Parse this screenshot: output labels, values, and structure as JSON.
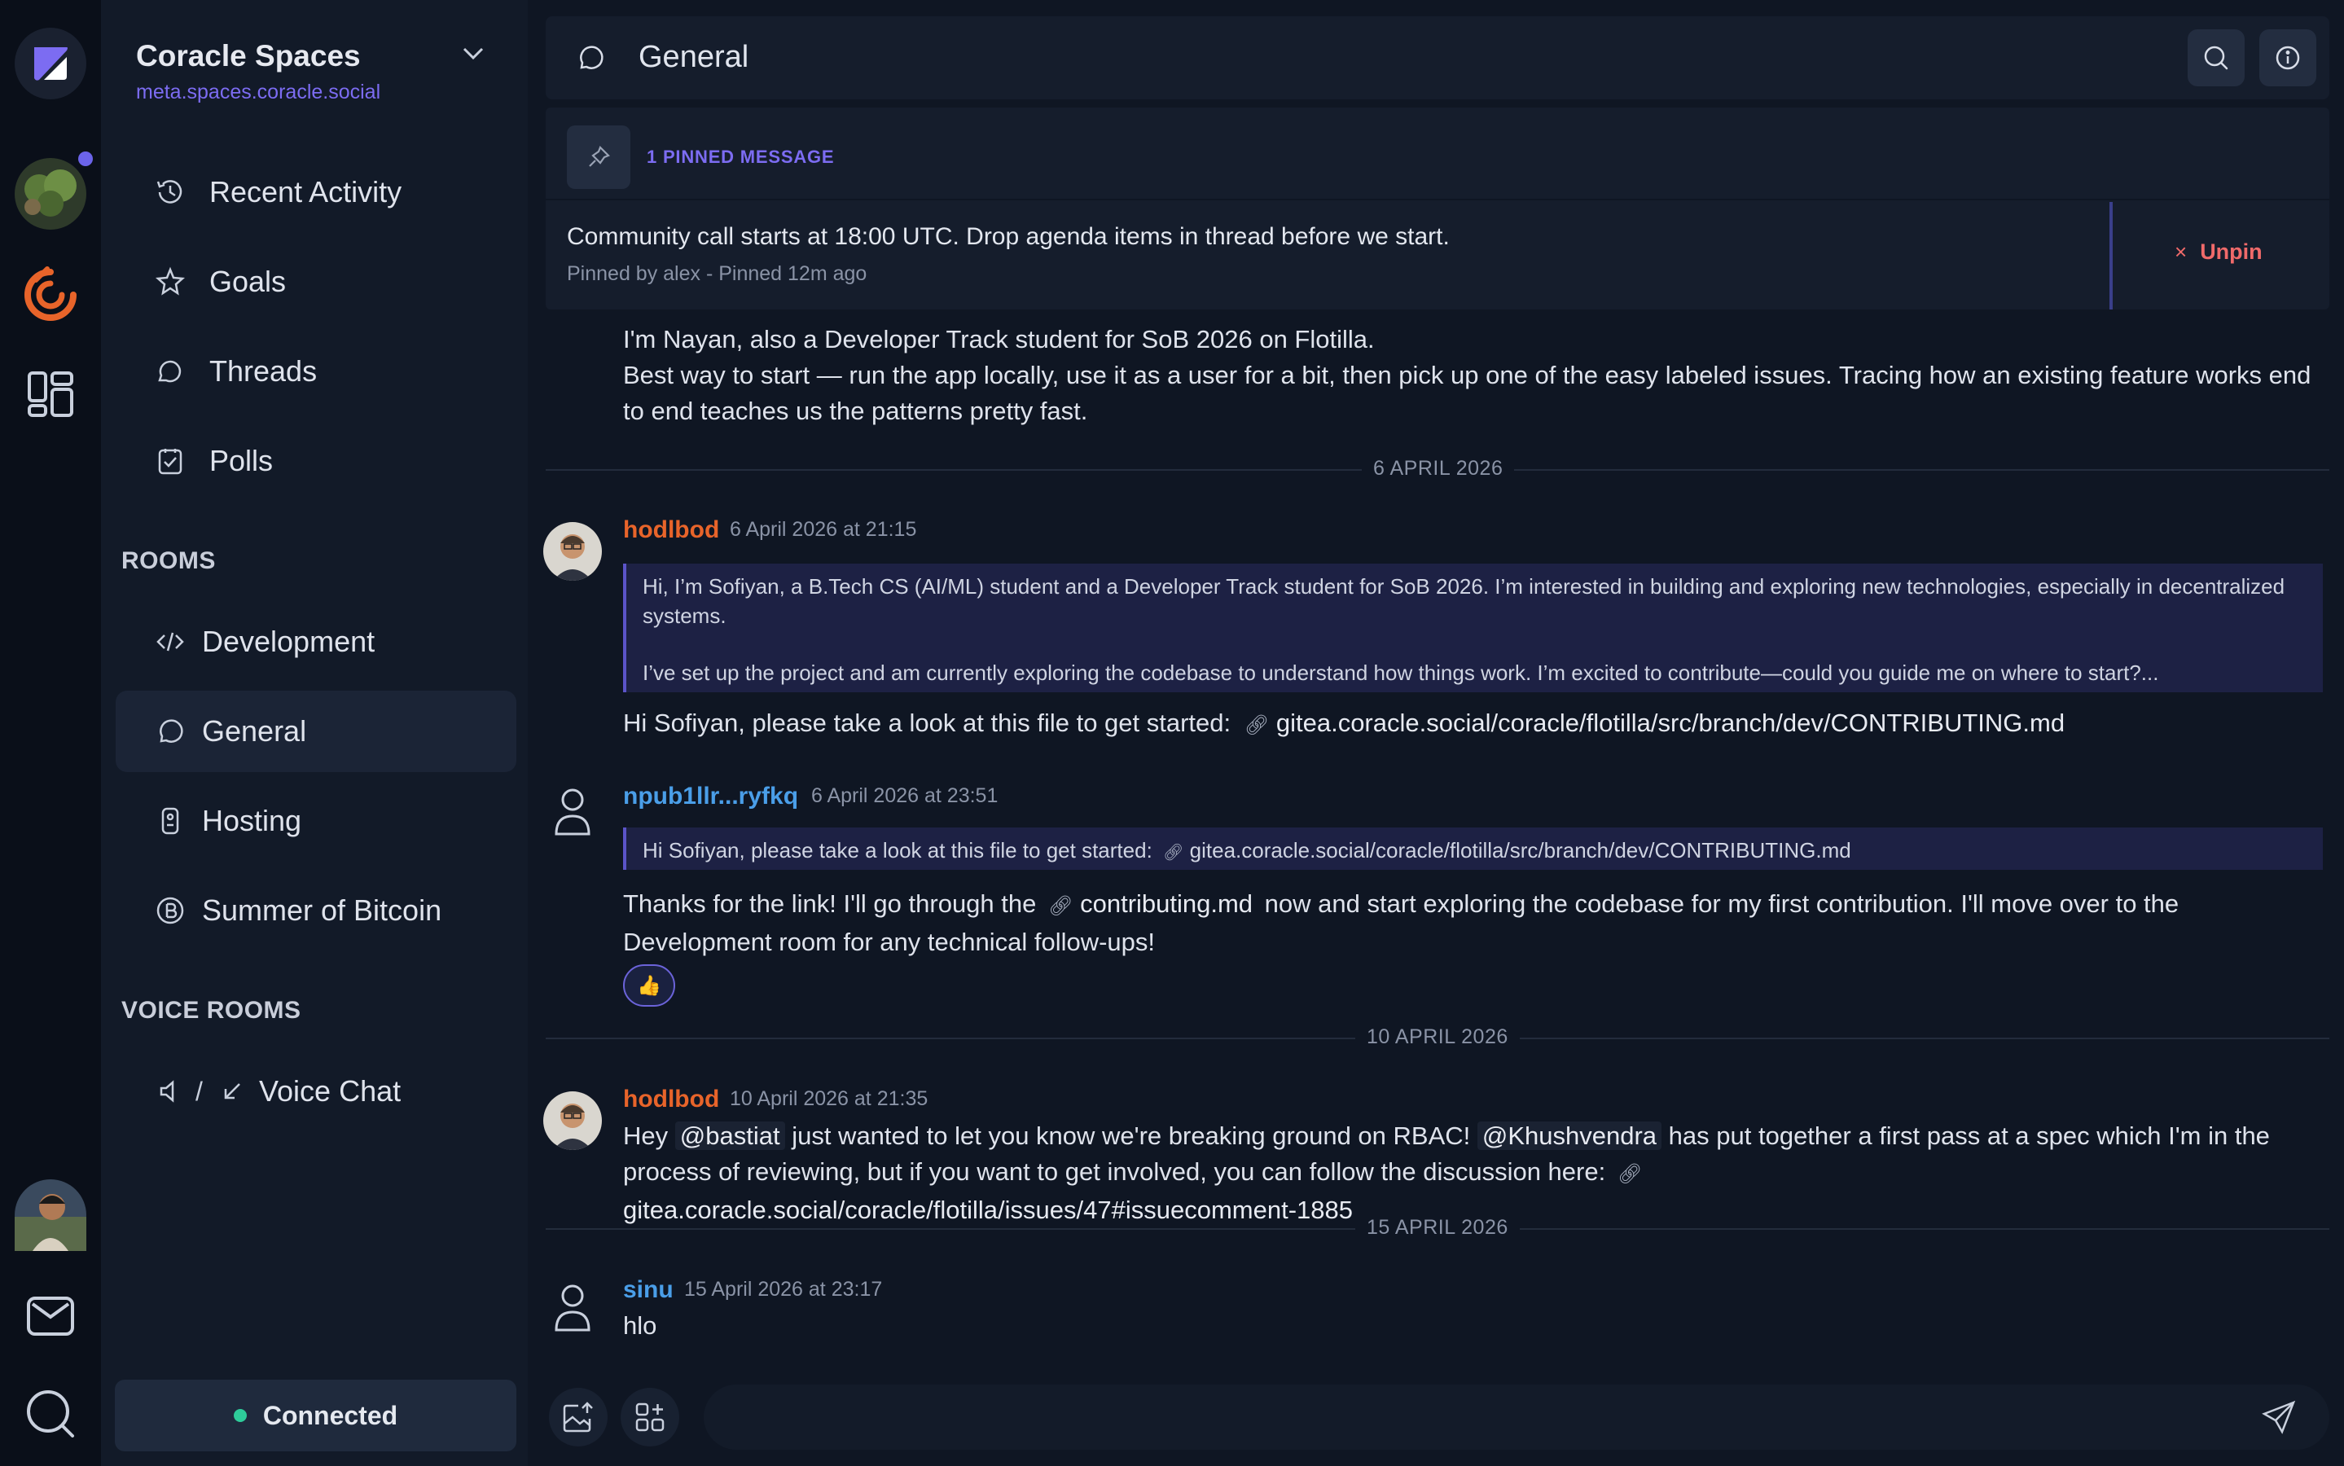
{
  "space": {
    "name": "Coracle Spaces",
    "url": "meta.spaces.coracle.social"
  },
  "nav": {
    "items": [
      {
        "label": "Recent Activity",
        "icon": "history-icon"
      },
      {
        "label": "Goals",
        "icon": "star-icon"
      },
      {
        "label": "Threads",
        "icon": "thread-icon"
      },
      {
        "label": "Polls",
        "icon": "poll-icon"
      }
    ]
  },
  "rooms": {
    "heading": "ROOMS",
    "items": [
      {
        "label": "Development",
        "icon": "code-icon"
      },
      {
        "label": "General",
        "icon": "chat-bubble-icon"
      },
      {
        "label": "Hosting",
        "icon": "server-icon"
      },
      {
        "label": "Summer of Bitcoin",
        "icon": "bitcoin-icon"
      }
    ]
  },
  "voice": {
    "heading": "VOICE ROOMS",
    "sep": "/",
    "items": [
      {
        "label": "Voice Chat"
      }
    ]
  },
  "status": {
    "connected": "Connected",
    "color": "#2ecc9a"
  },
  "channel": {
    "title": "General"
  },
  "pinned": {
    "count_label": "1 PINNED MESSAGE",
    "text": "Community call starts at 18:00 UTC. Drop agenda items in thread before we start.",
    "meta": "Pinned by alex - Pinned 12m ago",
    "unpin_label": "Unpin",
    "unpin_x": "×"
  },
  "messages": {
    "intro_line1": "I'm Nayan, also a Developer Track student for SoB 2026 on Flotilla.",
    "intro_line2": "Best way to start — run the app locally, use it as a user for a bit, then pick up one of the easy labeled issues. Tracing how an existing feature works end to end teaches us the patterns pretty fast.",
    "date1": "6 APRIL 2026",
    "m1_author": "hodlbod",
    "m1_time": "6 April 2026 at 21:15",
    "m1_quote_p1": "Hi, I’m Sofiyan, a B.Tech CS (AI/ML) student and a Developer Track student for SoB 2026. I’m interested in building and exploring new technologies, especially in decentralized systems.",
    "m1_quote_p2": "I’ve set up the project and am currently exploring the codebase to understand how things work. I’m excited to contribute—could you guide me on where to start?...",
    "m1_text": "Hi Sofiyan, please take a look at this file to get started:",
    "m1_link": "gitea.coracle.social/coracle/flotilla/src/branch/dev/CONTRIBUTING.md",
    "m2_author": "npub1llr...ryfkq",
    "m2_time": "6 April 2026 at 23:51",
    "m2_quote": "Hi Sofiyan, please take a look at this file to get started:",
    "m2_quote_link": "gitea.coracle.social/coracle/flotilla/src/branch/dev/CONTRIBUTING.md",
    "m2_text_a": "Thanks for the link! I'll go through the",
    "m2_link": "contributing.md",
    "m2_text_b": "now and start exploring the codebase for my first contribution. I'll move over to the Development room for any technical follow-ups!",
    "m2_reaction": "👍",
    "date2": "10 APRIL 2026",
    "m3_author": "hodlbod",
    "m3_time": "10 April 2026 at 21:35",
    "m3_a": "Hey",
    "m3_mention1": "@bastiat",
    "m3_b": "just wanted to let you know we're breaking ground on RBAC!",
    "m3_mention2": "@Khushvendra",
    "m3_c": "has put together a first pass at a spec which I'm in the process of reviewing, but if you want to get involved, you can follow the discussion here:",
    "m3_link": "gitea.coracle.social/coracle/flotilla/issues/47#issuecomment-1885",
    "date3": "15 APRIL 2026",
    "m4_author": "sinu",
    "m4_time": "15 April 2026 at 23:17",
    "m4_text": "hlo"
  },
  "colors": {
    "accent": "#7c6cf2",
    "author_orange": "#e8642a",
    "author_blue": "#4a9ee8",
    "danger": "#f06a6a"
  }
}
